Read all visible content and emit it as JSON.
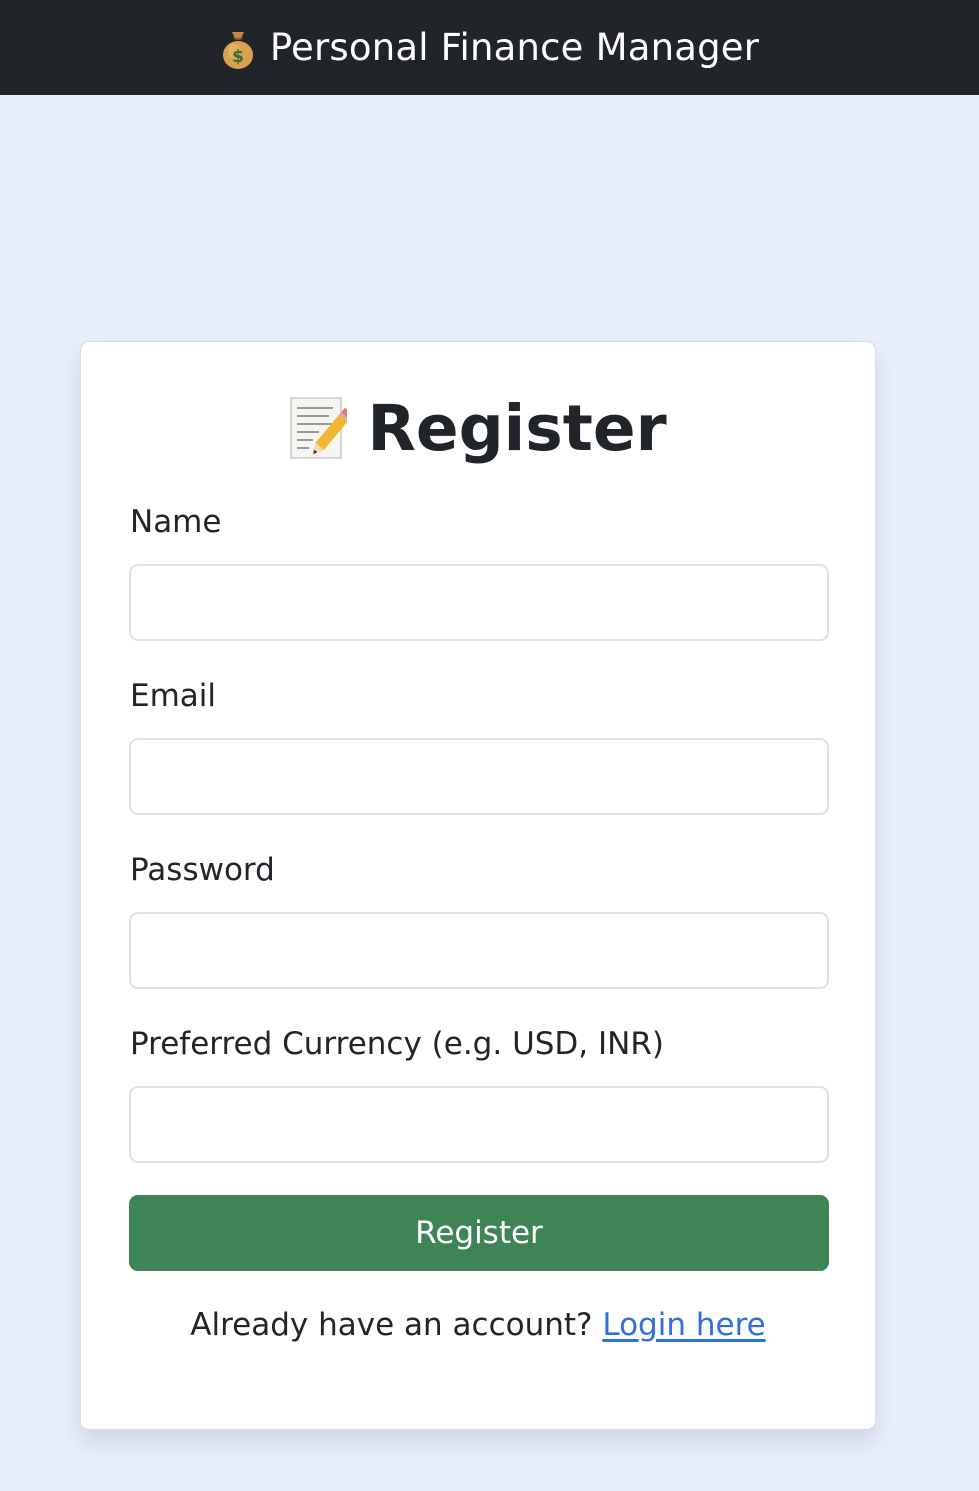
{
  "header": {
    "title": "Personal Finance Manager",
    "icon": "money-bag-icon"
  },
  "form": {
    "heading": "Register",
    "heading_icon": "memo-pencil-icon",
    "fields": [
      {
        "label": "Name",
        "value": "",
        "type": "text"
      },
      {
        "label": "Email",
        "value": "",
        "type": "email"
      },
      {
        "label": "Password",
        "value": "",
        "type": "password"
      },
      {
        "label": "Preferred Currency (e.g. USD, INR)",
        "value": "",
        "type": "text"
      }
    ],
    "submit_label": "Register",
    "footer_text": "Already have an account?",
    "login_link_label": "Login here"
  },
  "colors": {
    "header_bg": "#212529",
    "page_bg": "#e8eefb",
    "submit_bg": "#3f8457",
    "link": "#2f6fde"
  }
}
